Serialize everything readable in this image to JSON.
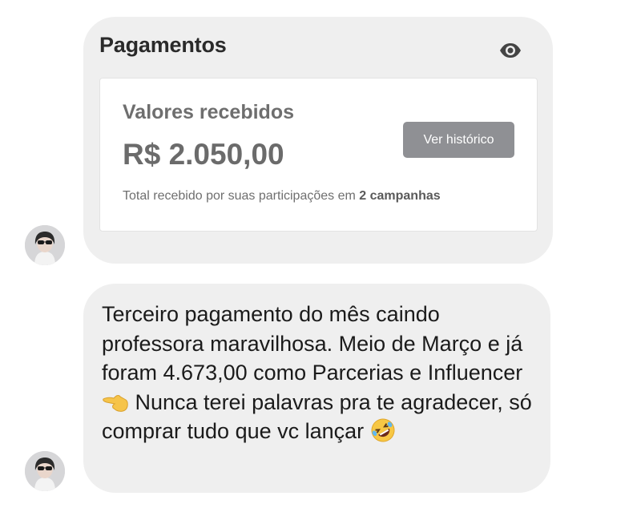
{
  "payment_card": {
    "title": "Pagamentos",
    "received_label": "Valores recebidos",
    "amount": "R$ 2.050,00",
    "history_button": "Ver histórico",
    "total_prefix": "Total recebido por suas participações em ",
    "total_campaigns": "2 campanhas"
  },
  "message": {
    "text_before_emoji": "Terceiro pagamento do mês caindo professora maravilhosa. Meio de Março e já foram 4.673,00 como Parcerias e Influencer ",
    "emoji_1": "pointing-left-hand-icon",
    "text_middle": " Nunca terei palavras pra te agradecer, só comprar tudo que vc lançar ",
    "emoji_2": "rolling-on-floor-laughing-icon"
  },
  "colors": {
    "bubble": "#efefef",
    "button": "#8f9094"
  }
}
